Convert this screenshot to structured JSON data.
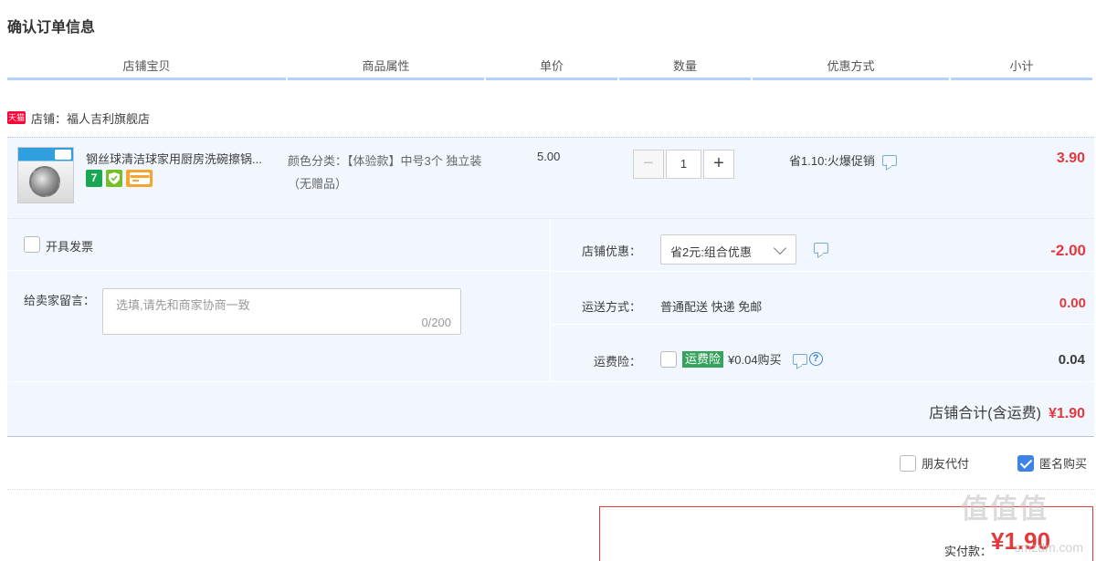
{
  "page": {
    "title": "确认订单信息"
  },
  "columns": [
    "店铺宝贝",
    "商品属性",
    "单价",
    "数量",
    "优惠方式",
    "小计"
  ],
  "shop": {
    "badge": "天猫",
    "label": "店铺：福人吉利旗舰店"
  },
  "item": {
    "title": "钢丝球清洁球家用厨房洗碗擦锅...",
    "service_icons": [
      "seven-day-return-icon",
      "shield-icon",
      "credit-card-icon"
    ],
    "attribute": "颜色分类：【体验款】中号3个 独立装（无赠品）",
    "price": "5.00",
    "quantity": "1",
    "minus_label": "−",
    "plus_label": "+",
    "promo": "省1.10:火爆促销",
    "subtotal": "3.90"
  },
  "invoice": {
    "label": "开具发票",
    "checked": false
  },
  "message": {
    "label": "给卖家留言：",
    "placeholder": "选填,请先和商家协商一致",
    "count": "0/200"
  },
  "shop_discount": {
    "label": "店铺优惠：",
    "selected": "省2元:组合优惠",
    "amount": "-2.00"
  },
  "shipping": {
    "label": "运送方式：",
    "value": "普通配送 快递 免邮",
    "amount": "0.00"
  },
  "insurance": {
    "label": "运费险：",
    "badge": "运费险",
    "text": "¥0.04购买",
    "amount": "0.04",
    "checked": false
  },
  "shop_total": {
    "label": "店铺合计(含运费)",
    "amount": "¥1.90"
  },
  "options": {
    "friend_pay": {
      "label": "朋友代付",
      "checked": false
    },
    "anonymous": {
      "label": "匿名购买",
      "checked": true
    }
  },
  "payment": {
    "label": "实付款：",
    "amount": "¥1.90"
  },
  "watermark": {
    "text": "值值值",
    "sub": "smzdm.com"
  },
  "colors": {
    "accent_red": "#e4393c",
    "header_underline": "#b2d1ff",
    "row_bg": "#f2f7ff",
    "insurance_green": "#36a35c",
    "checkbox_blue": "#3d83e6"
  }
}
